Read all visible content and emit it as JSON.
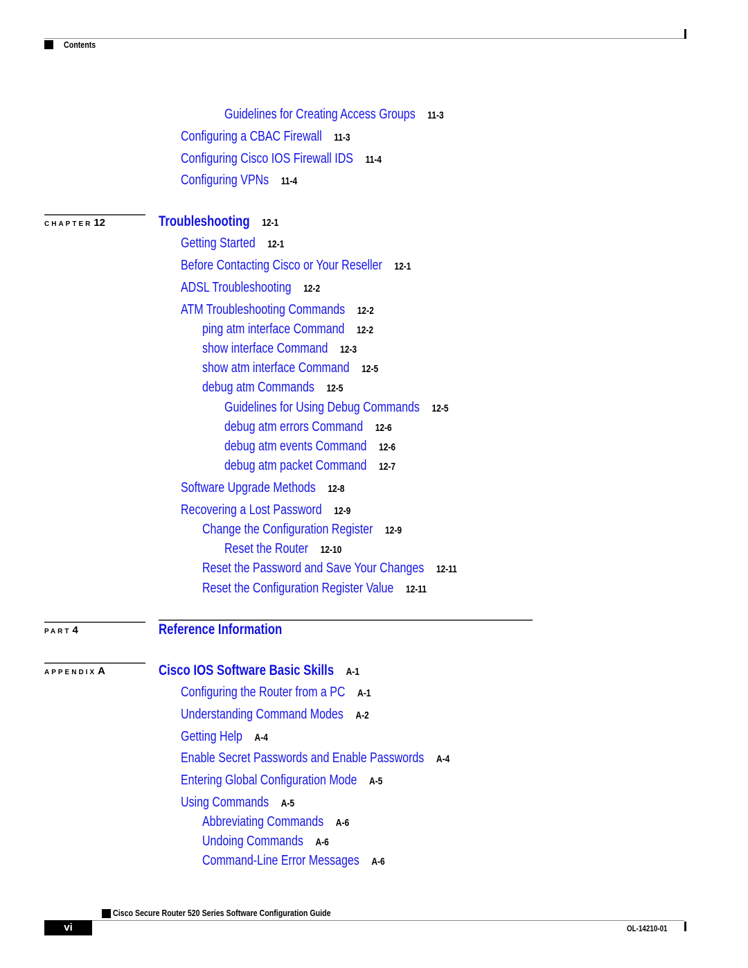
{
  "header": {
    "section_label": "Contents"
  },
  "sections": [
    {
      "kind": "continuation",
      "entries": [
        {
          "title": "Guidelines for Creating Access Groups",
          "page": "11-3",
          "level": 3
        },
        {
          "title": "Configuring a CBAC Firewall",
          "page": "11-3",
          "level": 1
        },
        {
          "title": "Configuring Cisco IOS Firewall IDS",
          "page": "11-4",
          "level": 1
        },
        {
          "title": "Configuring VPNs",
          "page": "11-4",
          "level": 1
        }
      ]
    },
    {
      "kind": "chapter",
      "label_word": "CHAPTER",
      "label_number": "12",
      "title": "Troubleshooting",
      "page": "12-1",
      "entries": [
        {
          "title": "Getting Started",
          "page": "12-1",
          "level": 1
        },
        {
          "title": "Before Contacting Cisco or Your Reseller",
          "page": "12-1",
          "level": 1
        },
        {
          "title": "ADSL Troubleshooting",
          "page": "12-2",
          "level": 1
        },
        {
          "title": "ATM Troubleshooting Commands",
          "page": "12-2",
          "level": 1
        },
        {
          "title": "ping atm interface Command",
          "page": "12-2",
          "level": 2
        },
        {
          "title": "show interface Command",
          "page": "12-3",
          "level": 2
        },
        {
          "title": "show atm interface Command",
          "page": "12-5",
          "level": 2
        },
        {
          "title": "debug atm Commands",
          "page": "12-5",
          "level": 2
        },
        {
          "title": "Guidelines for Using Debug Commands",
          "page": "12-5",
          "level": 3
        },
        {
          "title": "debug atm errors Command",
          "page": "12-6",
          "level": 3
        },
        {
          "title": "debug atm events Command",
          "page": "12-6",
          "level": 3
        },
        {
          "title": "debug atm packet Command",
          "page": "12-7",
          "level": 3
        },
        {
          "title": "Software Upgrade Methods",
          "page": "12-8",
          "level": 1
        },
        {
          "title": "Recovering a Lost Password",
          "page": "12-9",
          "level": 1
        },
        {
          "title": "Change the Configuration Register",
          "page": "12-9",
          "level": 2
        },
        {
          "title": "Reset the Router",
          "page": "12-10",
          "level": 3
        },
        {
          "title": "Reset the Password and Save Your Changes",
          "page": "12-11",
          "level": 2
        },
        {
          "title": "Reset the Configuration Register Value",
          "page": "12-11",
          "level": 2
        }
      ]
    },
    {
      "kind": "part",
      "label_word": "PART",
      "label_number": "4",
      "title": "Reference Information",
      "page": ""
    },
    {
      "kind": "appendix",
      "label_word": "APPENDIX",
      "label_number": "A",
      "title": "Cisco IOS Software Basic Skills",
      "page": "A-1",
      "entries": [
        {
          "title": "Configuring the Router from a PC",
          "page": "A-1",
          "level": 1
        },
        {
          "title": "Understanding Command Modes",
          "page": "A-2",
          "level": 1
        },
        {
          "title": "Getting Help",
          "page": "A-4",
          "level": 1
        },
        {
          "title": "Enable Secret Passwords and Enable Passwords",
          "page": "A-4",
          "level": 1
        },
        {
          "title": "Entering Global Configuration Mode",
          "page": "A-5",
          "level": 1
        },
        {
          "title": "Using Commands",
          "page": "A-5",
          "level": 1
        },
        {
          "title": "Abbreviating Commands",
          "page": "A-6",
          "level": 2
        },
        {
          "title": "Undoing Commands",
          "page": "A-6",
          "level": 2
        },
        {
          "title": "Command-Line Error Messages",
          "page": "A-6",
          "level": 2
        }
      ]
    }
  ],
  "footer": {
    "book_title": "Cisco Secure Router 520 Series Software Configuration Guide",
    "page_number": "vi",
    "doc_number": "OL-14210-01"
  },
  "colors": {
    "link_blue": "#1414e6",
    "heading_blue": "#1010e0",
    "text_black": "#000000"
  }
}
